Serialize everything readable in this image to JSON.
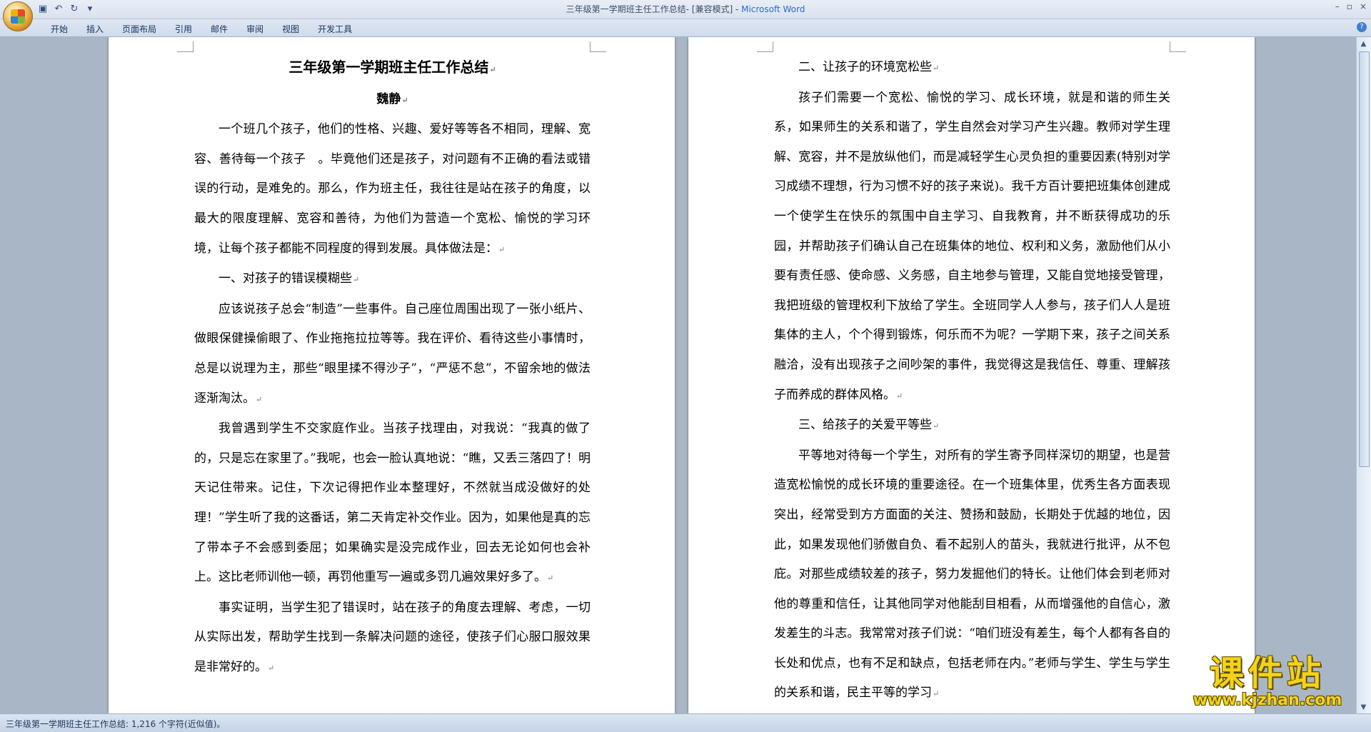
{
  "window": {
    "title_doc": "三年级第一学期班主任工作总结- [兼容模式] - ",
    "title_app": "Microsoft Word",
    "ctrl_min": "–",
    "ctrl_max": "▫",
    "ctrl_close": "×"
  },
  "qat": {
    "save": "▣",
    "undo": "↶",
    "redo": "↻",
    "more": "▾"
  },
  "ribbon": {
    "tabs": [
      "开始",
      "插入",
      "页面布局",
      "引用",
      "邮件",
      "审阅",
      "视图",
      "开发工具"
    ],
    "help": "?"
  },
  "document": {
    "title": "三年级第一学期班主任工作总结",
    "author": "魏静",
    "left_paragraphs": [
      "一个班几个孩子，他们的性格、兴趣、爱好等等各不相同，理解、宽容、善待每一个孩子　。毕竟他们还是孩子，对问题有不正确的看法或错误的行动，是难免的。那么，作为班主任，我往往是站在孩子的角度，以最大的限度理解、宽容和善待，为他们为营造一个宽松、愉悦的学习环境，让每个孩子都能不同程度的得到发展。具体做法是：",
      "一、对孩子的错误模糊些",
      "应该说孩子总会“制造”一些事件。自己座位周围出现了一张小纸片、做眼保健操偷眼了、作业拖拖拉拉等等。我在评价、看待这些小事情时，总是以说理为主，那些“眼里揉不得沙子”，“严惩不怠”，不留余地的做法逐渐淘汰。",
      "我曾遇到学生不交家庭作业。当孩子找理由，对我说：“我真的做了的，只是忘在家里了。”我呢，也会一脸认真地说：“瞧，又丢三落四了！明天记住带来。记住，下次记得把作业本整理好，不然就当成没做好的处理！”学生听了我的这番话，第二天肯定补交作业。因为，如果他是真的忘了带本子不会感到委屈；如果确实是没完成作业，回去无论如何也会补上。这比老师训他一顿，再罚他重写一遍或多罚几遍效果好多了。",
      "事实证明，当学生犯了错误时，站在孩子的角度去理解、考虑，一切从实际出发，帮助学生找到一条解决问题的途径，使孩子们心服口服效果是非常好的。"
    ],
    "right_paragraphs": [
      "二、让孩子的环境宽松些",
      "孩子们需要一个宽松、愉悦的学习、成长环境，就是和谐的师生关系，如果师生的关系和谐了，学生自然会对学习产生兴趣。教师对学生理解、宽容，并不是放纵他们，而是减轻学生心灵负担的重要因素(特别对学习成绩不理想，行为习惯不好的孩子来说)。我千方百计要把班集体创建成一个使学生在快乐的氛围中自主学习、自我教育，并不断获得成功的乐园，并帮助孩子们确认自己在班集体的地位、权利和义务，激励他们从小要有责任感、使命感、义务感，自主地参与管理，又能自觉地接受管理，我把班级的管理权利下放给了学生。全班同学人人参与，孩子们人人是班集体的主人，个个得到锻炼，何乐而不为呢？一学期下来，孩子之间关系融洽，没有出现孩子之间吵架的事件，我觉得这是我信任、尊重、理解孩子而养成的群体风格。",
      "三、给孩子的关爱平等些",
      "平等地对待每一个学生，对所有的学生寄予同样深切的期望，也是营造宽松愉悦的成长环境的重要途径。在一个班集体里，优秀生各方面表现突出，经常受到方方面面的关注、赞扬和鼓励，长期处于优越的地位，因此，如果发现他们骄傲自负、看不起别人的苗头，我就进行批评，从不包庇。对那些成绩较差的孩子，努力发掘他们的特长。让他们体会到老师对他的尊重和信任，让其他同学对他能刮目相看，从而增强他的自信心，激发差生的斗志。我常常对孩子们说：“咱们班没有差生，每个人都有各自的长处和优点，也有不足和缺点，包括老师在内。”老师与学生、学生与学生的关系和谐，民主平等的学习"
    ],
    "para_mark": "↵"
  },
  "status": {
    "text": "三年级第一学期班主任工作总结: 1,216 个字符(近似值)。"
  },
  "watermark": {
    "cn": "课件站",
    "url": "www.kjzhan.com"
  }
}
